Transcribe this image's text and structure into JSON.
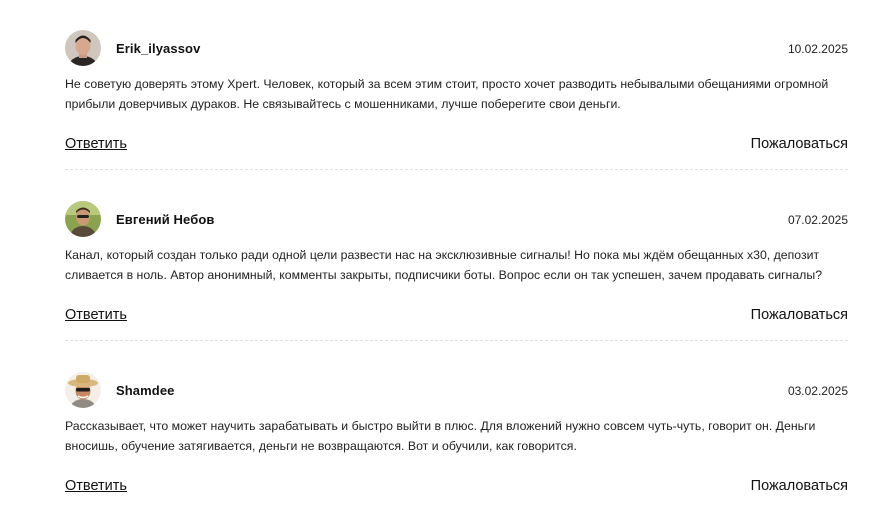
{
  "comments": [
    {
      "author": "Erik_ilyassov",
      "date": "10.02.2025",
      "text": "Не советую доверять этому Xpert. Человек, который за всем этим стоит, просто хочет разводить небывалыми обещаниями огромной прибыли доверчивых дураков. Не связывайтесь с мошенниками, лучше поберегите свои деньги.",
      "reply_label": "Ответить",
      "report_label": "Пожаловаться"
    },
    {
      "author": "Евгений Небов",
      "date": "07.02.2025",
      "text": "Канал, который создан только ради одной цели развести нас на эксклюзивные сигналы! Но пока мы ждём обещанных х30, депозит сливается в ноль. Автор анонимный, комменты закрыты, подписчики боты. Вопрос если он так успешен, зачем продавать сигналы?",
      "reply_label": "Ответить",
      "report_label": "Пожаловаться"
    },
    {
      "author": "Shamdee",
      "date": "03.02.2025",
      "text": "Рассказывает, что может научить зарабатывать и быстро выйти в плюс. Для вложений нужно совсем чуть-чуть, говорит он. Деньги вносишь, обучение затягивается, деньги не возвращаются. Вот и обучили, как говорится.",
      "reply_label": "Ответить",
      "report_label": "Пожаловаться"
    }
  ]
}
